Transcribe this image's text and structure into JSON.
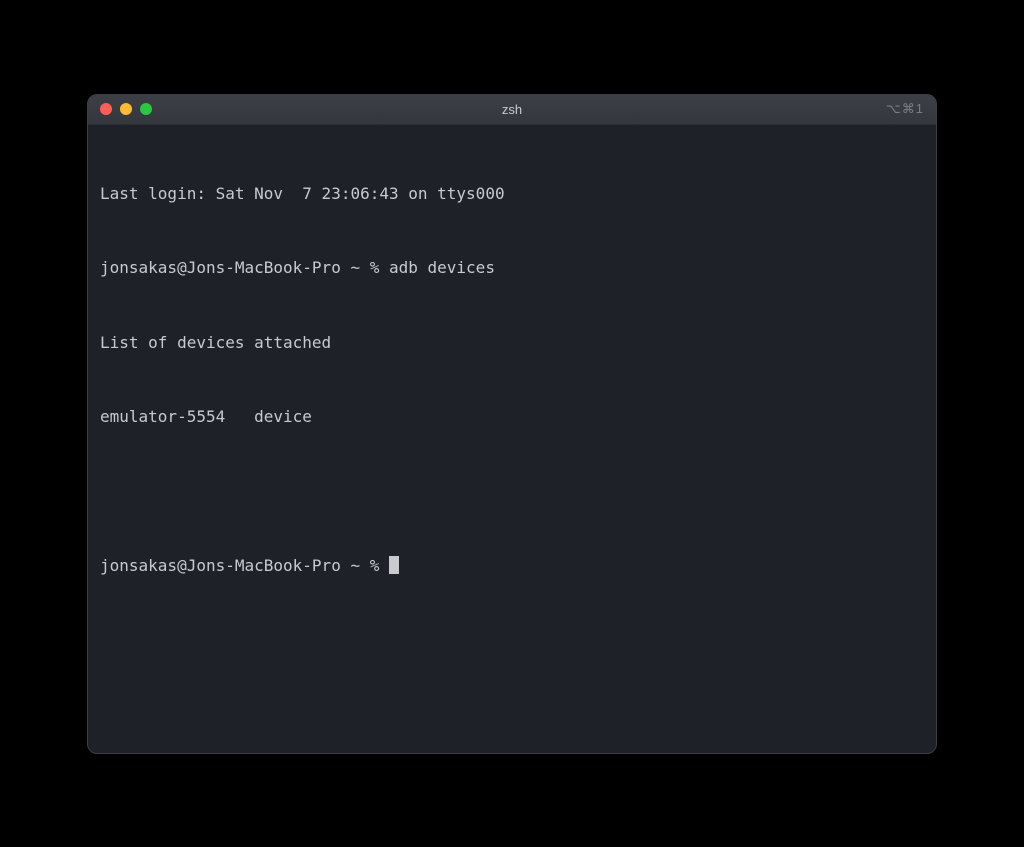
{
  "titlebar": {
    "title": "zsh",
    "tab_indicator": "⌥⌘1"
  },
  "terminal": {
    "lines": {
      "last_login": "Last login: Sat Nov  7 23:06:43 on ttys000",
      "prompt1": "jonsakas@Jons-MacBook-Pro ~ % ",
      "command1": "adb devices",
      "output_header": "List of devices attached",
      "output_device": "emulator-5554   device",
      "prompt2": "jonsakas@Jons-MacBook-Pro ~ % "
    }
  }
}
